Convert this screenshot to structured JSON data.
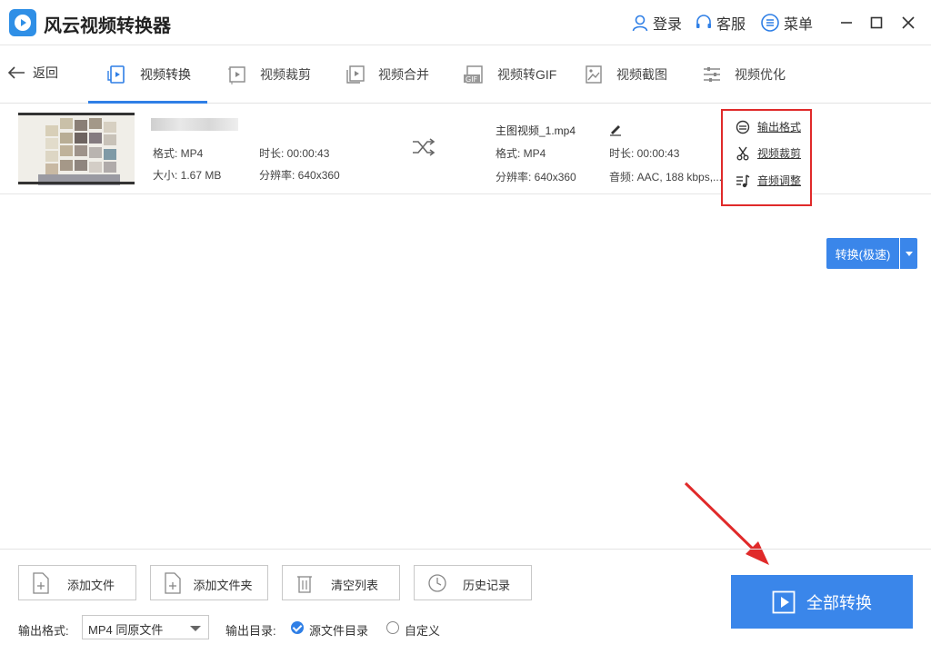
{
  "app": {
    "title": "风云视频转换器"
  },
  "titlebar": {
    "login": "登录",
    "service": "客服",
    "menu": "菜单"
  },
  "nav": {
    "back": "返回",
    "tabs": [
      {
        "label": "视频转换",
        "icon": "video-convert-icon",
        "active": true
      },
      {
        "label": "视频裁剪",
        "icon": "video-crop-icon"
      },
      {
        "label": "视频合并",
        "icon": "video-merge-icon"
      },
      {
        "label": "视频转GIF",
        "icon": "gif-icon"
      },
      {
        "label": "视频截图",
        "icon": "screenshot-icon"
      },
      {
        "label": "视频优化",
        "icon": "optimize-icon"
      }
    ]
  },
  "file": {
    "source": {
      "format": "格式: MP4",
      "duration": "时长: 00:00:43",
      "size": "大小: 1.67 MB",
      "resolution": "分辨率: 640x360"
    },
    "output": {
      "name": "主图视频_1.mp4",
      "format": "格式: MP4",
      "duration": "时长: 00:00:43",
      "resolution": "分辨率: 640x360",
      "audio": "音频: AAC, 188 kbps,..."
    },
    "options": {
      "output_format": "输出格式",
      "video_crop": "视频裁剪",
      "audio_adjust": "音频调整"
    },
    "convert_button": "转换(极速)"
  },
  "bottom": {
    "add_file": "添加文件",
    "add_folder": "添加文件夹",
    "clear_list": "清空列表",
    "history": "历史记录",
    "convert_all": "全部转换",
    "output_format_label": "输出格式:",
    "output_format_value": "MP4 同原文件",
    "output_dir_label": "输出目录:",
    "dir_source": "源文件目录",
    "dir_custom": "自定义"
  },
  "colors": {
    "accent": "#3a86ea",
    "highlight": "#e02a2a"
  }
}
